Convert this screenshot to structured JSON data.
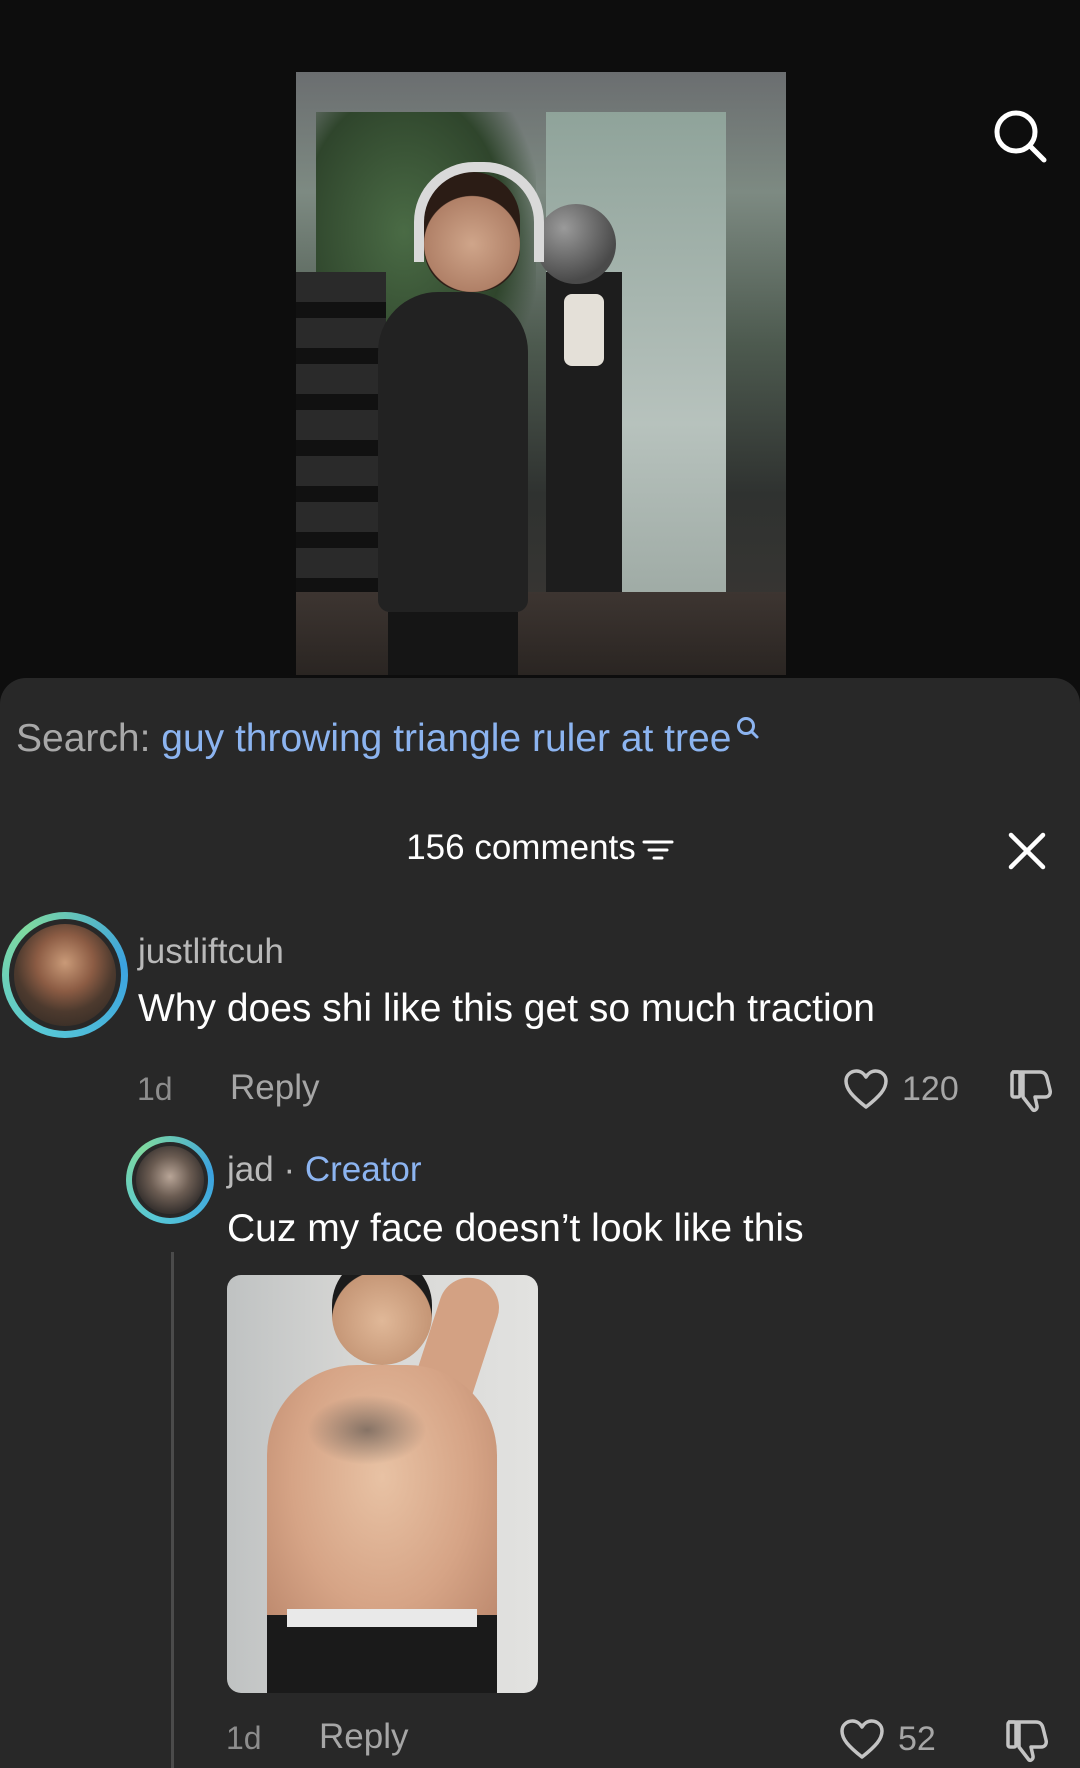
{
  "search": {
    "prefix": "Search:",
    "query": "guy throwing triangle ruler at tree"
  },
  "comments": {
    "count_label": "156 comments"
  },
  "thread": [
    {
      "username": "justliftcuh",
      "text": "Why does shi like this get so much traction",
      "time": "1d",
      "reply_label": "Reply",
      "likes": "120"
    },
    {
      "username": "jad",
      "separator": " · ",
      "badge": "Creator",
      "text": "Cuz my face doesn’t look like this",
      "time": "1d",
      "reply_label": "Reply",
      "likes": "52"
    }
  ],
  "icons": {
    "top_right": "search-icon",
    "close": "close-icon",
    "filter": "filter-icon",
    "like": "heart-icon",
    "dislike": "thumbs-down-icon"
  },
  "colors": {
    "accent_blue": "#8cb4f0",
    "sheet_bg": "#282828",
    "top_bg": "#0d0d0d"
  }
}
